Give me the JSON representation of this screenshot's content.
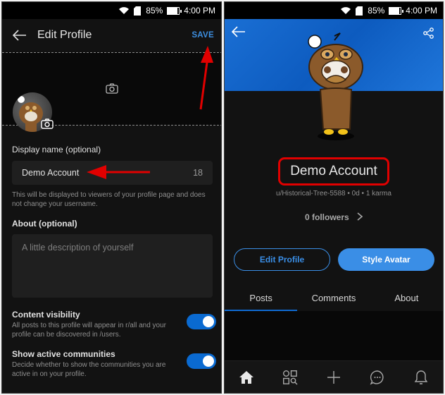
{
  "status_bar": {
    "battery": "85%",
    "time": "4:00 PM"
  },
  "edit_profile": {
    "title": "Edit Profile",
    "save_label": "SAVE",
    "display_name": {
      "label": "Display name (optional)",
      "value": "Demo Account",
      "remaining_chars": "18",
      "help": "This will be displayed to viewers of your profile page and does not change your username."
    },
    "about": {
      "label": "About (optional)",
      "placeholder": "A little description of yourself"
    },
    "settings": [
      {
        "title": "Content visibility",
        "description": "All posts to this profile will appear in r/all and your profile can be discovered in /users.",
        "enabled": true
      },
      {
        "title": "Show active communities",
        "description": "Decide whether to show the communities you are active in on your profile.",
        "enabled": true
      }
    ]
  },
  "profile": {
    "display_name": "Demo Account",
    "meta": "u/Historical-Tree-5588 • 0d • 1 karma",
    "followers": "0 followers",
    "buttons": {
      "edit": "Edit Profile",
      "style": "Style Avatar"
    },
    "tabs": [
      {
        "label": "Posts",
        "active": true
      },
      {
        "label": "Comments",
        "active": false
      },
      {
        "label": "About",
        "active": false
      }
    ],
    "nav": [
      "home-icon",
      "discover-icon",
      "create-icon",
      "chat-icon",
      "notifications-icon"
    ]
  },
  "colors": {
    "accent": "#3a8ee6",
    "toggle": "#0a6ad1",
    "annotation": "#e10000",
    "cover": "#1a6fd4"
  }
}
